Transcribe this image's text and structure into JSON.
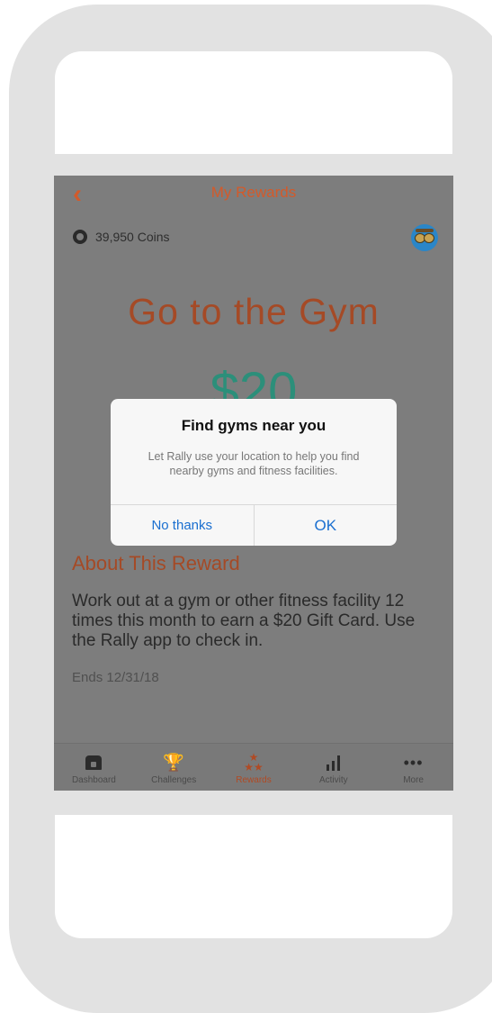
{
  "nav": {
    "back_icon": "chevron-left-icon",
    "title": "My Rewards"
  },
  "coins": {
    "label": "39,950 Coins"
  },
  "reward": {
    "title": "Go to the Gym",
    "amount": "$20",
    "about_heading": "About This Reward",
    "about_text": "Work out at a gym or other fitness facility 12 times this month to earn a $20 Gift Card. Use the Rally app to check in.",
    "ends": "Ends 12/31/18"
  },
  "tabs": [
    {
      "label": "Dashboard",
      "icon": "home-icon"
    },
    {
      "label": "Challenges",
      "icon": "trophy-icon"
    },
    {
      "label": "Rewards",
      "icon": "stars-icon",
      "active": true
    },
    {
      "label": "Activity",
      "icon": "activity-icon"
    },
    {
      "label": "More",
      "icon": "more-icon"
    }
  ],
  "alert": {
    "title": "Find gyms near you",
    "message": "Let Rally use your location to help you find nearby gyms and fitness facilities.",
    "cancel_label": "No thanks",
    "ok_label": "OK"
  },
  "colors": {
    "accent": "#d35a2a",
    "money": "#2c8f7a",
    "link": "#1a6fd0",
    "overlay": "#7d7d7d"
  }
}
